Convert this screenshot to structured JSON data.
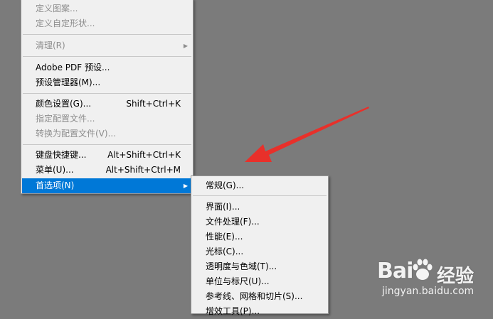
{
  "main_menu": {
    "items": [
      {
        "label": "定义图案...",
        "shortcut": "",
        "disabled": true
      },
      {
        "label": "定义自定形状...",
        "shortcut": "",
        "disabled": true
      },
      {
        "label": "清理(R)",
        "shortcut": "",
        "disabled": true
      },
      {
        "label": "Adobe PDF 预设...",
        "shortcut": "",
        "disabled": false
      },
      {
        "label": "预设管理器(M)...",
        "shortcut": "",
        "disabled": false
      },
      {
        "label": "颜色设置(G)...",
        "shortcut": "Shift+Ctrl+K",
        "disabled": false
      },
      {
        "label": "指定配置文件...",
        "shortcut": "",
        "disabled": true
      },
      {
        "label": "转换为配置文件(V)...",
        "shortcut": "",
        "disabled": true
      },
      {
        "label": "键盘快捷键...",
        "shortcut": "Alt+Shift+Ctrl+K",
        "disabled": false
      },
      {
        "label": "菜单(U)...",
        "shortcut": "Alt+Shift+Ctrl+M",
        "disabled": false
      },
      {
        "label": "首选项(N)",
        "shortcut": "",
        "disabled": false,
        "highlighted": true
      }
    ]
  },
  "sub_menu": {
    "items": [
      {
        "label": "常规(G)..."
      },
      {
        "label": "界面(I)..."
      },
      {
        "label": "文件处理(F)..."
      },
      {
        "label": "性能(E)..."
      },
      {
        "label": "光标(C)..."
      },
      {
        "label": "透明度与色域(T)..."
      },
      {
        "label": "单位与标尺(U)..."
      },
      {
        "label": "参考线、网格和切片(S)..."
      },
      {
        "label": "增效工具(P)..."
      }
    ]
  },
  "watermark": {
    "brand": "Bai",
    "brand_suffix": "经验",
    "url": "jingyan.baidu.com"
  },
  "colors": {
    "background": "#7b7b7b",
    "menu_bg": "#f0f0f0",
    "highlight": "#0078d7",
    "arrow": "#e8302a",
    "disabled_text": "#8d8d8d"
  },
  "icons": {
    "submenu_arrow": "triangle-right-icon",
    "annotation": "red-arrow-icon",
    "logo": "baidu-paw-icon"
  }
}
